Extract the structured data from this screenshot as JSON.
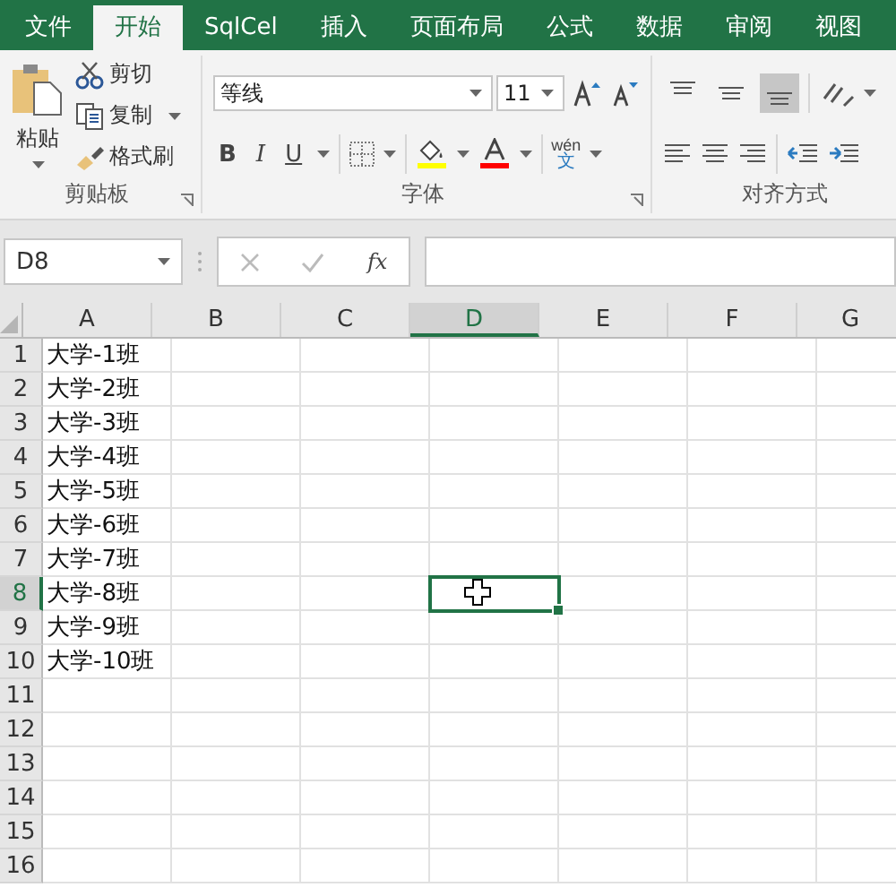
{
  "tabs": [
    {
      "label": "文件",
      "selected": false
    },
    {
      "label": "开始",
      "selected": true
    },
    {
      "label": "SqlCel",
      "selected": false
    },
    {
      "label": "插入",
      "selected": false
    },
    {
      "label": "页面布局",
      "selected": false
    },
    {
      "label": "公式",
      "selected": false
    },
    {
      "label": "数据",
      "selected": false
    },
    {
      "label": "审阅",
      "selected": false
    },
    {
      "label": "视图",
      "selected": false
    }
  ],
  "clipboard": {
    "paste": "粘贴",
    "cut": "剪切",
    "copy": "复制",
    "format_painter": "格式刷",
    "label": "剪贴板"
  },
  "font": {
    "font_name": "等线",
    "font_size": "11",
    "bold": "B",
    "italic": "I",
    "underline": "U",
    "phonetic_top": "wén",
    "phonetic_bottom": "文",
    "label": "字体"
  },
  "alignment": {
    "vertical": [
      {
        "selected": false
      },
      {
        "selected": false
      },
      {
        "selected": true
      }
    ],
    "label": "对齐方式"
  },
  "name_box": "D8",
  "function_button": "fx",
  "columns": [
    {
      "label": "A",
      "selected": false
    },
    {
      "label": "B",
      "selected": false
    },
    {
      "label": "C",
      "selected": false
    },
    {
      "label": "D",
      "selected": true
    },
    {
      "label": "E",
      "selected": false
    },
    {
      "label": "F",
      "selected": false
    },
    {
      "label": "G",
      "selected": false
    }
  ],
  "rows": [
    {
      "label": "1",
      "selected": false,
      "value": "大学-1班"
    },
    {
      "label": "2",
      "selected": false,
      "value": "大学-2班"
    },
    {
      "label": "3",
      "selected": false,
      "value": "大学-3班"
    },
    {
      "label": "4",
      "selected": false,
      "value": "大学-4班"
    },
    {
      "label": "5",
      "selected": false,
      "value": "大学-5班"
    },
    {
      "label": "6",
      "selected": false,
      "value": "大学-6班"
    },
    {
      "label": "7",
      "selected": false,
      "value": "大学-7班"
    },
    {
      "label": "8",
      "selected": true,
      "value": "大学-8班"
    },
    {
      "label": "9",
      "selected": false,
      "value": "大学-9班"
    },
    {
      "label": "10",
      "selected": false,
      "value": "大学-10班"
    },
    {
      "label": "11",
      "selected": false
    },
    {
      "label": "12",
      "selected": false
    },
    {
      "label": "13",
      "selected": false
    },
    {
      "label": "14",
      "selected": false
    },
    {
      "label": "15",
      "selected": false
    },
    {
      "label": "16",
      "selected": false
    }
  ]
}
